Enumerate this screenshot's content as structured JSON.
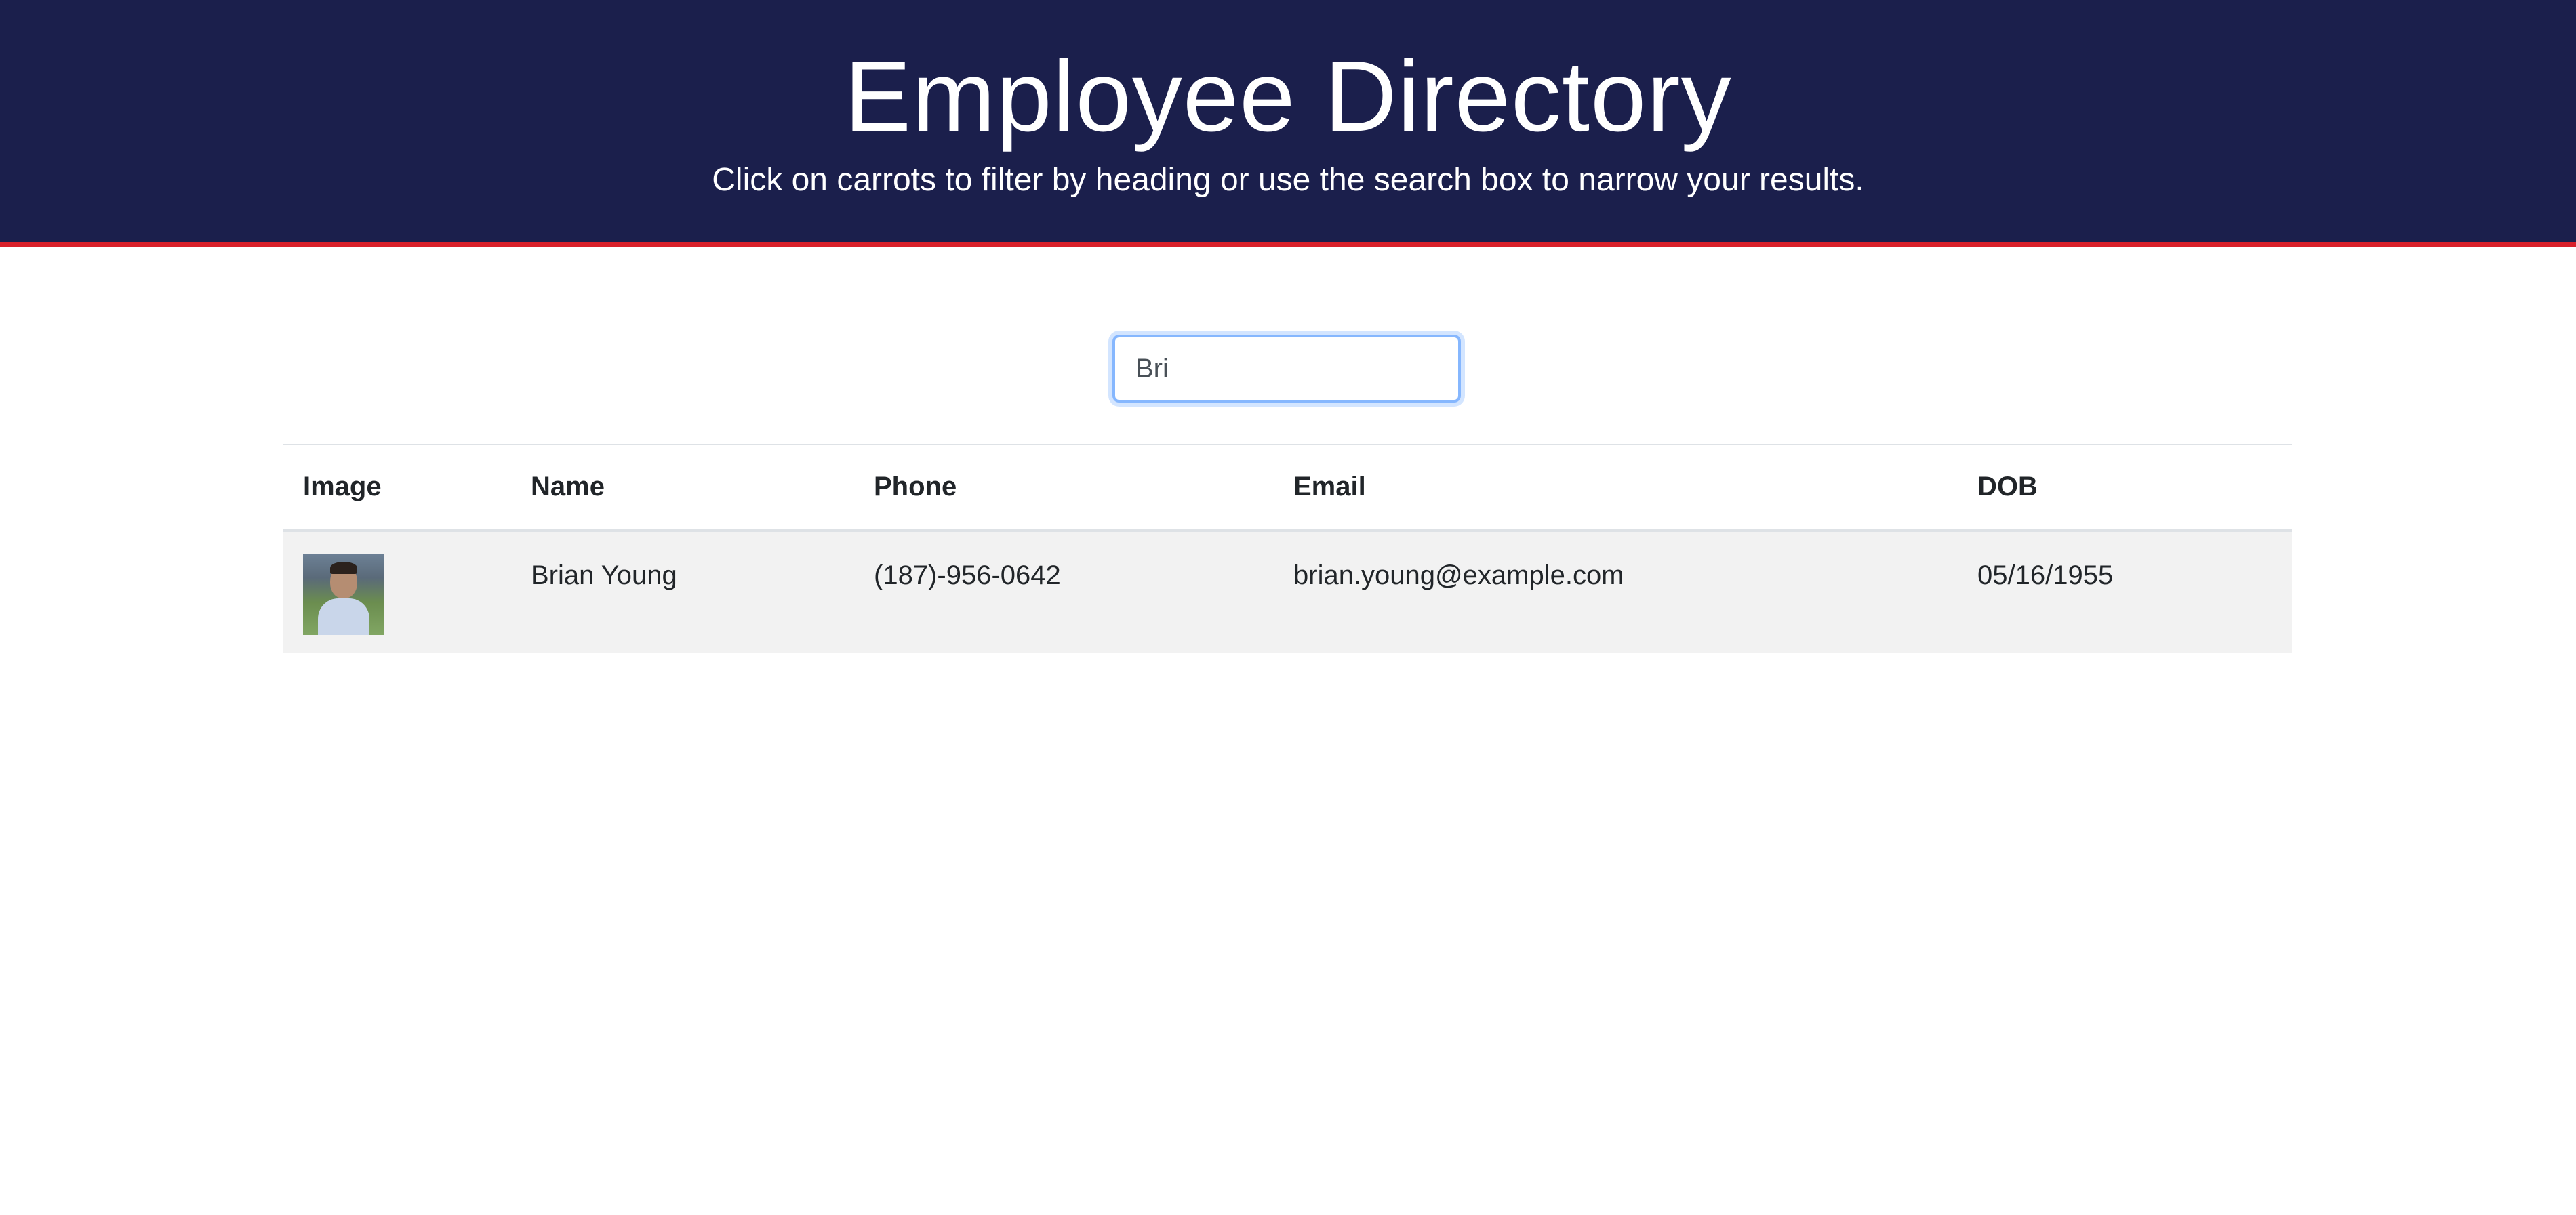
{
  "header": {
    "title": "Employee Directory",
    "subtitle": "Click on carrots to filter by heading or use the search box to narrow your results."
  },
  "search": {
    "value": "Bri"
  },
  "table": {
    "columns": [
      "Image",
      "Name",
      "Phone",
      "Email",
      "DOB"
    ],
    "rows": [
      {
        "image": "employee-photo",
        "name": "Brian Young",
        "phone": "(187)-956-0642",
        "email": "brian.young@example.com",
        "dob": "05/16/1955"
      }
    ]
  },
  "colors": {
    "header_bg": "#1b1f4c",
    "header_border": "#d9202a",
    "row_bg": "#f2f2f2"
  }
}
